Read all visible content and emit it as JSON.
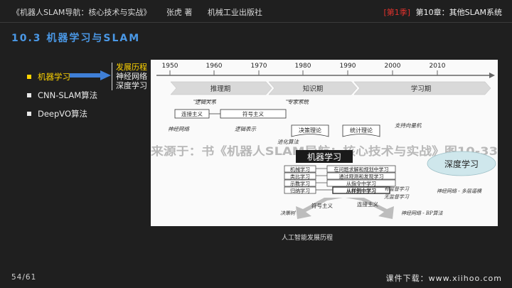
{
  "header": {
    "book": "《机器人SLAM导航：核心技术与实战》",
    "author": "张虎 著",
    "publisher": "机械工业出版社",
    "act": "[第1季]",
    "chapter": "第10章：其他SLAM系统"
  },
  "section_title": "10.3 机器学习与SLAM",
  "menu": {
    "items": [
      {
        "label": "机器学习"
      },
      {
        "label": "CNN-SLAM算法"
      },
      {
        "label": "DeepVO算法"
      }
    ],
    "sub_items": [
      "发展历程",
      "神经网络",
      "深度学习"
    ]
  },
  "figure": {
    "years": [
      "1950",
      "1960",
      "1970",
      "1980",
      "1990",
      "2000",
      "2010"
    ],
    "periods": [
      "推理期",
      "知识期",
      "学习期"
    ],
    "labels": {
      "logic_relation": "逻辑关系",
      "expert_system": "专家系统",
      "connectionism": "连接主义",
      "symbolism": "符号主义",
      "svm": "支持向量机",
      "neural_net": "神经网络",
      "logic_repr": "逻辑表示",
      "decision_theory": "决策理论",
      "statistical_theory": "统计理论",
      "evolution": "进化算法",
      "ml_box": "机器学习",
      "dl_blob": "深度学习",
      "ml_item": "机械学习",
      "analogy": "类比学习",
      "instruct": "示教学习",
      "induction": "归纳学习",
      "problem_solving": "在问题求解和规划中学习",
      "observation": "通过观测和发现学习",
      "instruction": "从指令中学习",
      "from_examples": "从样例中学习",
      "supervised": "有监督学习",
      "unsupervised": "无监督学习",
      "nn_multi": "神经网络 - 多层逼横",
      "decision_tree": "决策树",
      "symbolism2": "符号主义",
      "connectionism2": "连接主义",
      "bp": "神经网络 - BP算法",
      "watermark": "来源于：书《机器人SLAM导航：核心技术与实战》图10-33"
    }
  },
  "caption": "人工智能发展历程",
  "footer": {
    "page": "54/61",
    "site": "课件下载：www.xiihoo.com"
  },
  "colors": {
    "accent": "#4a98e6",
    "highlight": "#ffd400",
    "act_red": "#e0322d"
  }
}
